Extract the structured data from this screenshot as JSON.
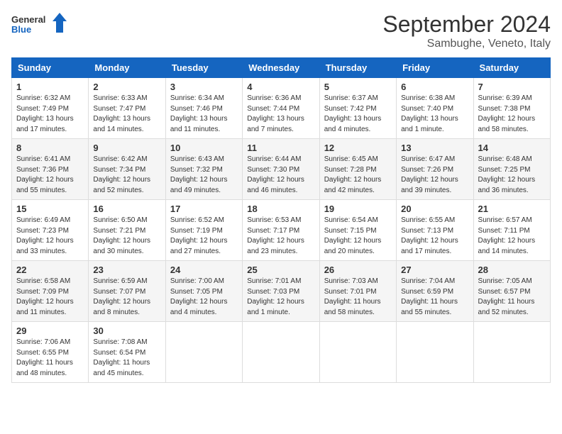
{
  "header": {
    "logo_general": "General",
    "logo_blue": "Blue",
    "month": "September 2024",
    "location": "Sambughe, Veneto, Italy"
  },
  "weekdays": [
    "Sunday",
    "Monday",
    "Tuesday",
    "Wednesday",
    "Thursday",
    "Friday",
    "Saturday"
  ],
  "weeks": [
    [
      {
        "day": "1",
        "info": "Sunrise: 6:32 AM\nSunset: 7:49 PM\nDaylight: 13 hours\nand 17 minutes."
      },
      {
        "day": "2",
        "info": "Sunrise: 6:33 AM\nSunset: 7:47 PM\nDaylight: 13 hours\nand 14 minutes."
      },
      {
        "day": "3",
        "info": "Sunrise: 6:34 AM\nSunset: 7:46 PM\nDaylight: 13 hours\nand 11 minutes."
      },
      {
        "day": "4",
        "info": "Sunrise: 6:36 AM\nSunset: 7:44 PM\nDaylight: 13 hours\nand 7 minutes."
      },
      {
        "day": "5",
        "info": "Sunrise: 6:37 AM\nSunset: 7:42 PM\nDaylight: 13 hours\nand 4 minutes."
      },
      {
        "day": "6",
        "info": "Sunrise: 6:38 AM\nSunset: 7:40 PM\nDaylight: 13 hours\nand 1 minute."
      },
      {
        "day": "7",
        "info": "Sunrise: 6:39 AM\nSunset: 7:38 PM\nDaylight: 12 hours\nand 58 minutes."
      }
    ],
    [
      {
        "day": "8",
        "info": "Sunrise: 6:41 AM\nSunset: 7:36 PM\nDaylight: 12 hours\nand 55 minutes."
      },
      {
        "day": "9",
        "info": "Sunrise: 6:42 AM\nSunset: 7:34 PM\nDaylight: 12 hours\nand 52 minutes."
      },
      {
        "day": "10",
        "info": "Sunrise: 6:43 AM\nSunset: 7:32 PM\nDaylight: 12 hours\nand 49 minutes."
      },
      {
        "day": "11",
        "info": "Sunrise: 6:44 AM\nSunset: 7:30 PM\nDaylight: 12 hours\nand 46 minutes."
      },
      {
        "day": "12",
        "info": "Sunrise: 6:45 AM\nSunset: 7:28 PM\nDaylight: 12 hours\nand 42 minutes."
      },
      {
        "day": "13",
        "info": "Sunrise: 6:47 AM\nSunset: 7:26 PM\nDaylight: 12 hours\nand 39 minutes."
      },
      {
        "day": "14",
        "info": "Sunrise: 6:48 AM\nSunset: 7:25 PM\nDaylight: 12 hours\nand 36 minutes."
      }
    ],
    [
      {
        "day": "15",
        "info": "Sunrise: 6:49 AM\nSunset: 7:23 PM\nDaylight: 12 hours\nand 33 minutes."
      },
      {
        "day": "16",
        "info": "Sunrise: 6:50 AM\nSunset: 7:21 PM\nDaylight: 12 hours\nand 30 minutes."
      },
      {
        "day": "17",
        "info": "Sunrise: 6:52 AM\nSunset: 7:19 PM\nDaylight: 12 hours\nand 27 minutes."
      },
      {
        "day": "18",
        "info": "Sunrise: 6:53 AM\nSunset: 7:17 PM\nDaylight: 12 hours\nand 23 minutes."
      },
      {
        "day": "19",
        "info": "Sunrise: 6:54 AM\nSunset: 7:15 PM\nDaylight: 12 hours\nand 20 minutes."
      },
      {
        "day": "20",
        "info": "Sunrise: 6:55 AM\nSunset: 7:13 PM\nDaylight: 12 hours\nand 17 minutes."
      },
      {
        "day": "21",
        "info": "Sunrise: 6:57 AM\nSunset: 7:11 PM\nDaylight: 12 hours\nand 14 minutes."
      }
    ],
    [
      {
        "day": "22",
        "info": "Sunrise: 6:58 AM\nSunset: 7:09 PM\nDaylight: 12 hours\nand 11 minutes."
      },
      {
        "day": "23",
        "info": "Sunrise: 6:59 AM\nSunset: 7:07 PM\nDaylight: 12 hours\nand 8 minutes."
      },
      {
        "day": "24",
        "info": "Sunrise: 7:00 AM\nSunset: 7:05 PM\nDaylight: 12 hours\nand 4 minutes."
      },
      {
        "day": "25",
        "info": "Sunrise: 7:01 AM\nSunset: 7:03 PM\nDaylight: 12 hours\nand 1 minute."
      },
      {
        "day": "26",
        "info": "Sunrise: 7:03 AM\nSunset: 7:01 PM\nDaylight: 11 hours\nand 58 minutes."
      },
      {
        "day": "27",
        "info": "Sunrise: 7:04 AM\nSunset: 6:59 PM\nDaylight: 11 hours\nand 55 minutes."
      },
      {
        "day": "28",
        "info": "Sunrise: 7:05 AM\nSunset: 6:57 PM\nDaylight: 11 hours\nand 52 minutes."
      }
    ],
    [
      {
        "day": "29",
        "info": "Sunrise: 7:06 AM\nSunset: 6:55 PM\nDaylight: 11 hours\nand 48 minutes."
      },
      {
        "day": "30",
        "info": "Sunrise: 7:08 AM\nSunset: 6:54 PM\nDaylight: 11 hours\nand 45 minutes."
      },
      {
        "day": "",
        "info": ""
      },
      {
        "day": "",
        "info": ""
      },
      {
        "day": "",
        "info": ""
      },
      {
        "day": "",
        "info": ""
      },
      {
        "day": "",
        "info": ""
      }
    ]
  ]
}
